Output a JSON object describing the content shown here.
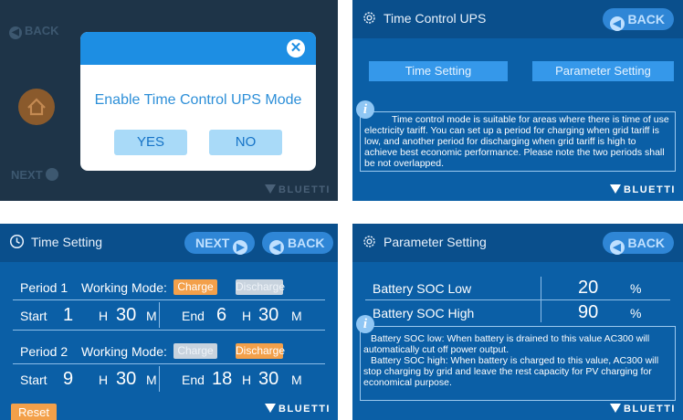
{
  "dialog_screen": {
    "side_back_label": "BACK",
    "side_next_label": "NEXT",
    "message": "Enable Time Control UPS Mode",
    "yes_label": "YES",
    "no_label": "NO",
    "close_glyph": "✕",
    "logo": "BLUETTI",
    "icons": [
      "back-icon",
      "home-icon",
      "next-icon",
      "close-icon"
    ]
  },
  "time_control_screen": {
    "title": "Time Control UPS",
    "back_label": "BACK",
    "time_setting_label": "Time Setting",
    "parameter_setting_label": "Parameter Setting",
    "info_text": "Time control mode is suitable for areas where there is time of use electricity tariff. You can set up a period for charging when grid tariff is low, and another period for discharging when grid tariff is high to achieve best economic performance. Please note the two periods shall be not overlapped.",
    "logo": "BLUETTI"
  },
  "time_setting_screen": {
    "title": "Time Setting",
    "next_label": "NEXT",
    "back_label": "BACK",
    "working_mode_label": "Working Mode:",
    "start_label": "Start",
    "end_label": "End",
    "h_label": "H",
    "m_label": "M",
    "charge_label": "Charge",
    "discharge_label": "Discharge",
    "period1": {
      "label": "Period 1",
      "start_h": "1",
      "start_m": "30",
      "end_h": "6",
      "end_m": "30",
      "active_mode": "Charge"
    },
    "period2": {
      "label": "Period 2",
      "start_h": "9",
      "start_m": "30",
      "end_h": "18",
      "end_m": "30",
      "active_mode": "Discharge"
    },
    "reset_label": "Reset",
    "logo": "BLUETTI"
  },
  "parameter_setting_screen": {
    "title": "Parameter Setting",
    "back_label": "BACK",
    "soc_low_label": "Battery SOC Low",
    "soc_low_value": "20",
    "soc_high_label": "Battery SOC High",
    "soc_high_value": "90",
    "unit": "%",
    "info_text_1": "Battery SOC low: When battery is drained to this value AC300 will automatically cut off power output.",
    "info_text_2": "Battery SOC high: When battery is charged to this value, AC300 will stop charging by grid and leave the rest capacity for PV charging for economical purpose.",
    "logo": "BLUETTI"
  },
  "colors": {
    "screen_blue": "#0b5fa6",
    "header_blue": "#0a4f8c",
    "button_blue": "#3598ea",
    "accent_orange": "#f3a04a",
    "dialog_blue": "#1d8ee3"
  }
}
